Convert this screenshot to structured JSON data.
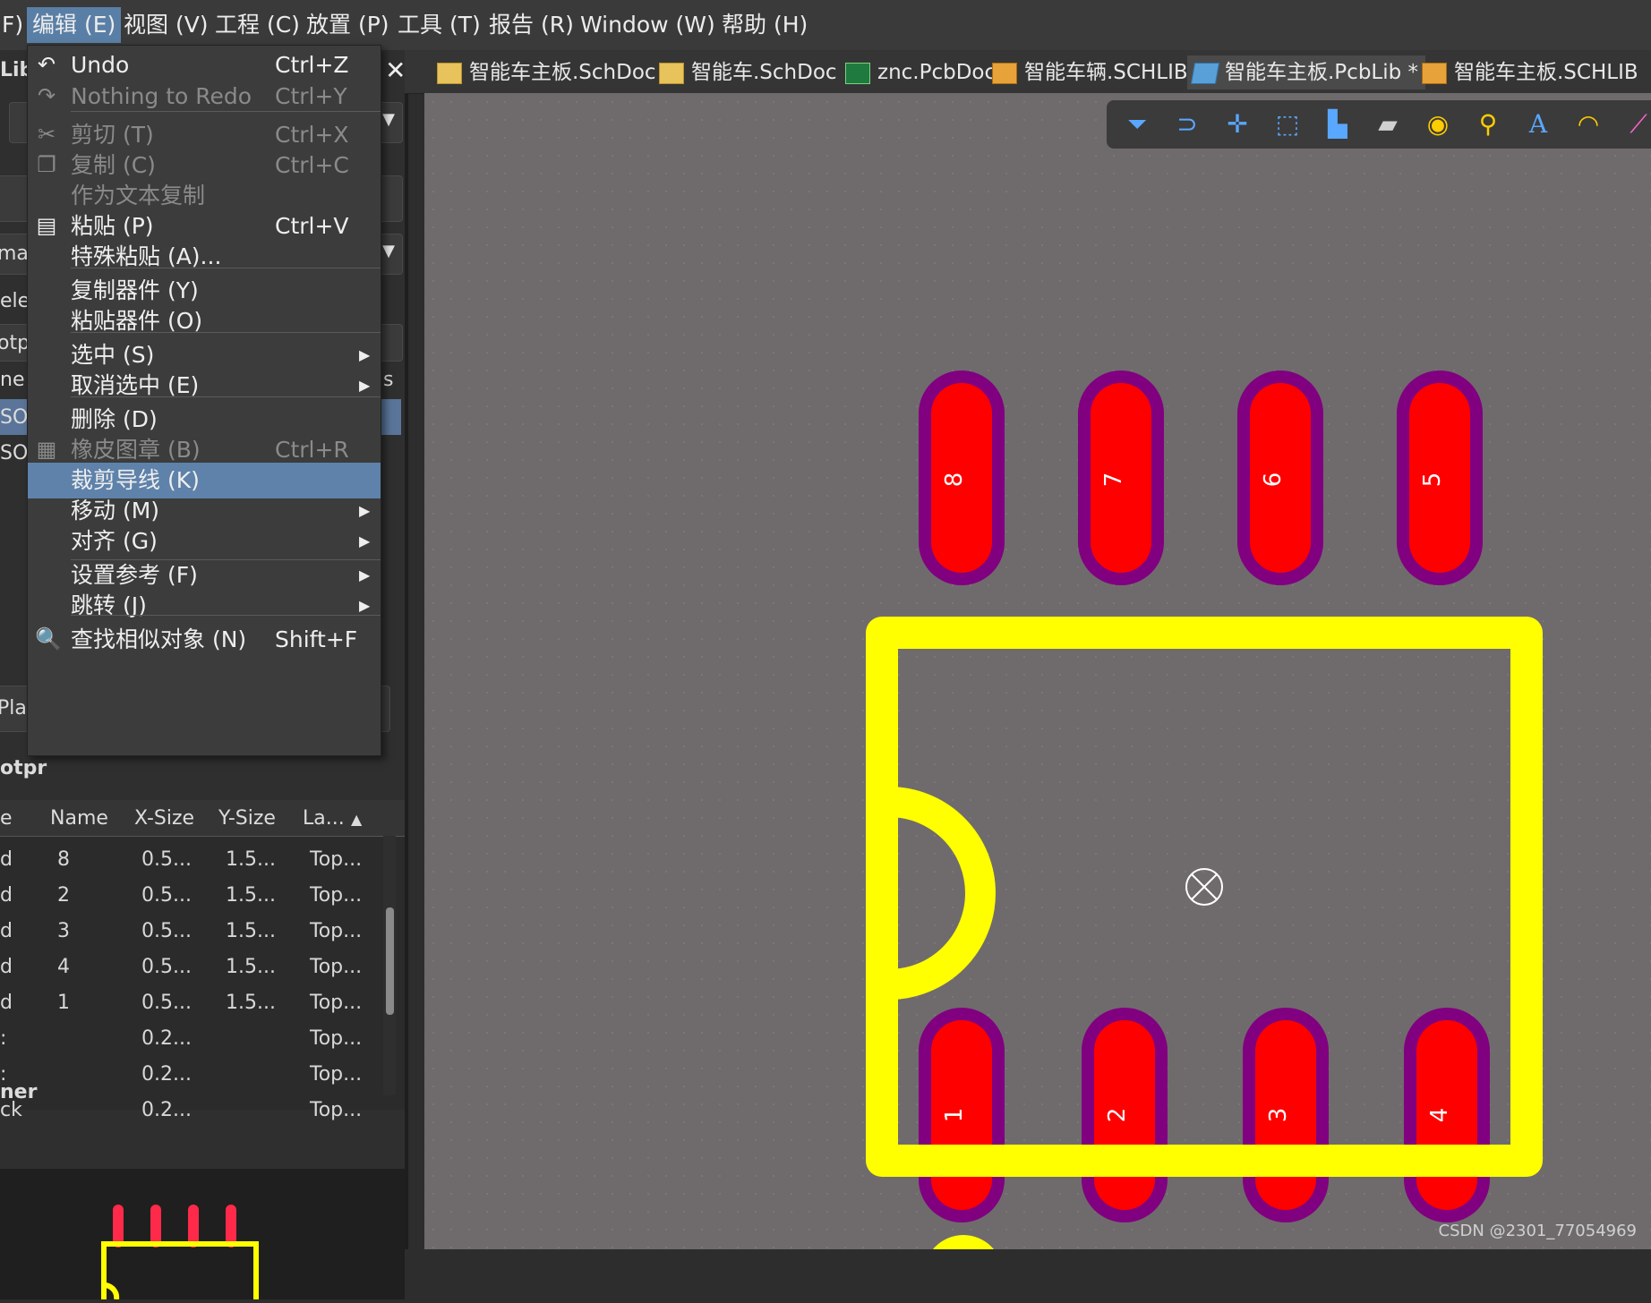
{
  "menubar": {
    "items": [
      "F)",
      "编辑 (E)",
      "视图 (V)",
      "工程 (C)",
      "放置 (P)",
      "工具 (T)",
      "报告 (R)",
      "Window (W)",
      "帮助 (H)"
    ]
  },
  "tabs": [
    {
      "label": "智能车主板.SchDoc",
      "icon": "schdoc-icon"
    },
    {
      "label": "智能车.SchDoc",
      "icon": "schdoc-icon"
    },
    {
      "label": "znc.PcbDoc",
      "icon": "pcbdoc-icon"
    },
    {
      "label": "智能车辆.SCHLIB",
      "icon": "schlib-icon"
    },
    {
      "label": "智能车主板.PcbLib *",
      "icon": "pcblib-icon"
    },
    {
      "label": "智能车主板.SCHLIB",
      "icon": "schlib-icon"
    }
  ],
  "edit_menu": {
    "items": [
      {
        "label": "Undo",
        "shortcut": "Ctrl+Z",
        "icon": "undo-icon",
        "disabled": false
      },
      {
        "label": "Nothing to Redo",
        "shortcut": "Ctrl+Y",
        "icon": "redo-icon",
        "disabled": true
      },
      {
        "label": "剪切 (T)",
        "shortcut": "Ctrl+X",
        "icon": "scissors-icon",
        "disabled": true
      },
      {
        "label": "复制 (C)",
        "shortcut": "Ctrl+C",
        "icon": "copy-icon",
        "disabled": true
      },
      {
        "label": "作为文本复制",
        "shortcut": "",
        "disabled": true
      },
      {
        "label": "粘贴 (P)",
        "shortcut": "Ctrl+V",
        "icon": "paste-icon",
        "disabled": false
      },
      {
        "label": "特殊粘贴 (A)...",
        "shortcut": "",
        "disabled": false
      },
      {
        "label": "复制器件 (Y)",
        "shortcut": "",
        "disabled": false
      },
      {
        "label": "粘贴器件 (O)",
        "shortcut": "",
        "disabled": false
      },
      {
        "label": "选中 (S)",
        "shortcut": "",
        "submenu": true,
        "disabled": false
      },
      {
        "label": "取消选中 (E)",
        "shortcut": "",
        "submenu": true,
        "disabled": false
      },
      {
        "label": "删除 (D)",
        "shortcut": "",
        "disabled": false
      },
      {
        "label": "橡皮图章 (B)",
        "shortcut": "Ctrl+R",
        "icon": "stamp-icon",
        "disabled": true
      },
      {
        "label": "裁剪导线 (K)",
        "shortcut": "",
        "highlighted": true,
        "disabled": false
      },
      {
        "label": "移动 (M)",
        "shortcut": "",
        "submenu": true,
        "disabled": false
      },
      {
        "label": "对齐 (G)",
        "shortcut": "",
        "submenu": true,
        "disabled": false
      },
      {
        "label": "设置参考 (F)",
        "shortcut": "",
        "submenu": true,
        "disabled": false
      },
      {
        "label": "跳转 (J)",
        "shortcut": "",
        "submenu": true,
        "disabled": false
      },
      {
        "label": "查找相似对象 (N)",
        "shortcut": "Shift+F",
        "icon": "magnifier-icon",
        "disabled": false
      }
    ]
  },
  "left_panel": {
    "fragments": [
      "Lib",
      "ma",
      "ele",
      "otp",
      "ne",
      "s",
      "SOD",
      "SOD",
      "Plac",
      "otpr",
      "ner"
    ],
    "pad_table": {
      "columns": [
        "e",
        "Name",
        "X-Size",
        "Y-Size",
        "La..."
      ],
      "rows": [
        [
          "d",
          "8",
          "0.5...",
          "1.5...",
          "Top..."
        ],
        [
          "d",
          "2",
          "0.5...",
          "1.5...",
          "Top..."
        ],
        [
          "d",
          "3",
          "0.5...",
          "1.5...",
          "Top..."
        ],
        [
          "d",
          "4",
          "0.5...",
          "1.5...",
          "Top..."
        ],
        [
          "d",
          "1",
          "0.5...",
          "1.5...",
          "Top..."
        ],
        [
          ":",
          "",
          "0.2...",
          "",
          "Top..."
        ],
        [
          ":",
          "",
          "0.2...",
          "",
          "Top..."
        ],
        [
          "ck",
          "",
          "0.2...",
          "",
          "Top..."
        ]
      ]
    }
  },
  "footprint": {
    "pins_top": [
      "8",
      "7",
      "6",
      "5"
    ],
    "pins_bottom": [
      "1",
      "2",
      "3",
      "4"
    ],
    "colors": {
      "pad": "#ff0000",
      "pad_ring": "#800080",
      "outline": "#ffff00",
      "canvas": "#6f6b6c"
    }
  },
  "toolbar_icons": [
    "filter-icon",
    "snap-icon",
    "cross-icon",
    "select-rect-icon",
    "align-chart-icon",
    "component-icon",
    "pad-icon",
    "via-icon",
    "text-icon",
    "arc-icon",
    "line-icon"
  ],
  "watermark": "CSDN @2301_77054969"
}
